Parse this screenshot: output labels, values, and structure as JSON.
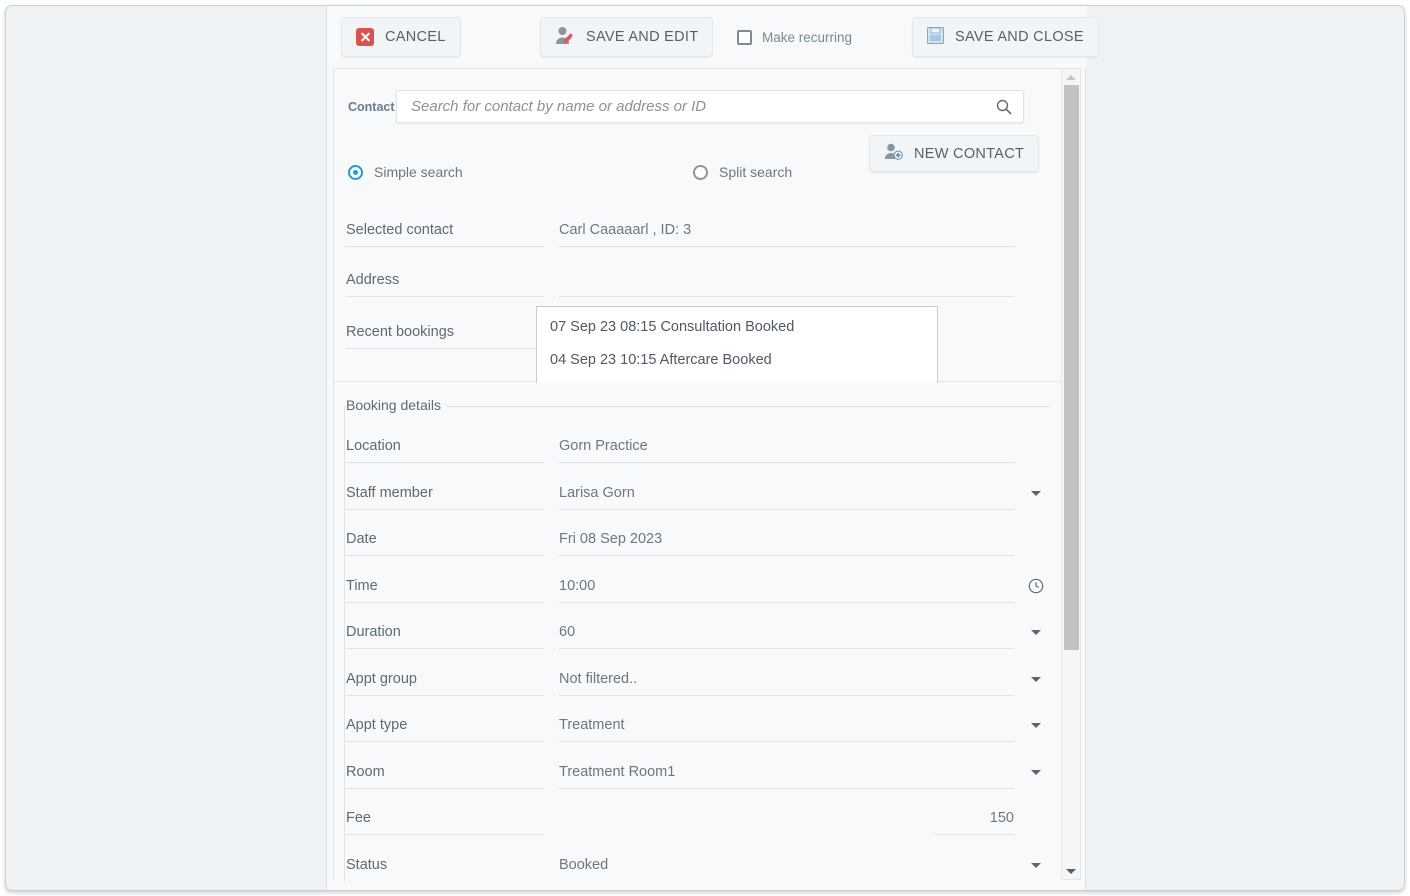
{
  "toolbar": {
    "cancel_label": "CANCEL",
    "save_and_edit_label": "SAVE AND EDIT",
    "make_recurring_label": "Make recurring",
    "save_and_close_label": "SAVE AND CLOSE"
  },
  "contact_section": {
    "contact_label": "Contact",
    "search_placeholder": "Search for contact by name or address or ID",
    "search_value": "",
    "new_contact_label": "NEW CONTACT",
    "simple_search_label": "Simple search",
    "split_search_label": "Split search",
    "selected_search_mode": "Simple search",
    "selected_contact_label": "Selected contact",
    "selected_contact_value": "Carl Caaaaarl , ID: 3",
    "address_label": "Address",
    "address_value": "",
    "recent_bookings_label": "Recent bookings",
    "recent_bookings": [
      "07 Sep 23 08:15 Consultation Booked",
      "04 Sep 23 10:15 Aftercare Booked"
    ]
  },
  "booking_details": {
    "legend": "Booking details",
    "fields": [
      {
        "label": "Location",
        "value": "Gorn Practice",
        "caret": false
      },
      {
        "label": "Staff member",
        "value": "Larisa Gorn",
        "caret": true
      },
      {
        "label": "Date",
        "value": "Fri 08 Sep 2023",
        "caret": false
      },
      {
        "label": "Time",
        "value": "10:00",
        "caret": false
      },
      {
        "label": "Duration",
        "value": "60",
        "caret": true
      },
      {
        "label": "Appt group",
        "value": "Not filtered..",
        "caret": true
      },
      {
        "label": "Appt type",
        "value": "Treatment",
        "caret": true
      },
      {
        "label": "Room",
        "value": "Treatment Room1",
        "caret": true
      },
      {
        "label": "Fee",
        "value": "150",
        "caret": false
      },
      {
        "label": "Status",
        "value": "Booked",
        "caret": true
      }
    ]
  },
  "icons": {
    "cancel": "cancel-x-icon",
    "save_and_edit": "user-edit-icon",
    "save_and_close": "floppy-disk-icon",
    "new_contact": "user-add-icon",
    "search": "search-icon",
    "time": "clock-icon"
  },
  "colors": {
    "accent": "#1e9bd7",
    "danger": "#d9534f",
    "page_bg": "#eef2f5",
    "panel_bg": "#f7f9fa",
    "text": "#6d7781"
  },
  "scrollbar": {
    "position_percent": 0
  }
}
